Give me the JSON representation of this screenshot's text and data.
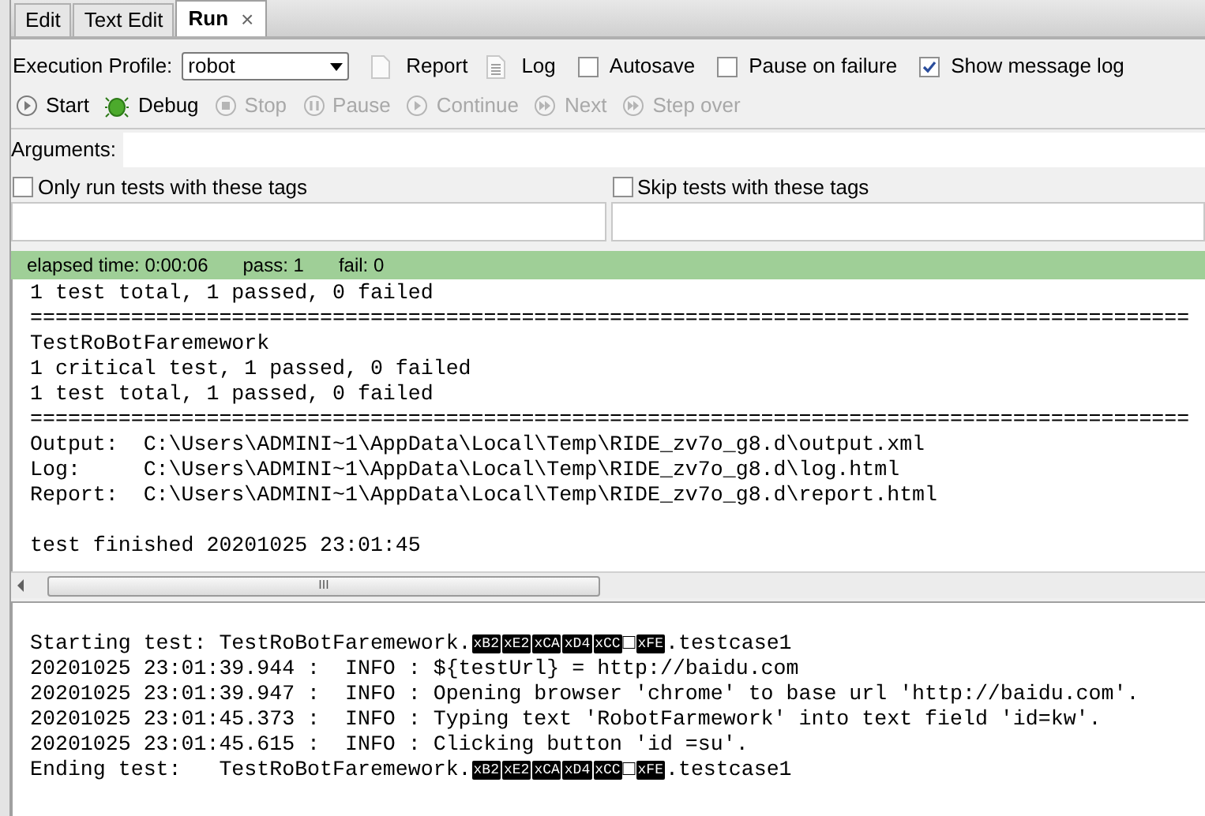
{
  "tabs": [
    {
      "label": "Edit",
      "selected": false
    },
    {
      "label": "Text Edit",
      "selected": false
    },
    {
      "label": "Run",
      "selected": true,
      "close": "×"
    }
  ],
  "profile": {
    "label": "Execution Profile:",
    "value": "robot"
  },
  "report_button": {
    "label": "Report"
  },
  "log_button": {
    "label": "Log"
  },
  "options": [
    {
      "label": "Autosave",
      "checked": false
    },
    {
      "label": "Pause on failure",
      "checked": false
    },
    {
      "label": "Show message log",
      "checked": true
    }
  ],
  "controls": [
    {
      "label": "Start",
      "kind": "play",
      "disabled": false
    },
    {
      "label": "Debug",
      "kind": "bug",
      "disabled": false
    },
    {
      "label": "Stop",
      "kind": "stop",
      "disabled": true
    },
    {
      "label": "Pause",
      "kind": "pause",
      "disabled": true
    },
    {
      "label": "Continue",
      "kind": "play",
      "disabled": true
    },
    {
      "label": "Next",
      "kind": "next",
      "disabled": true
    },
    {
      "label": "Step over",
      "kind": "next",
      "disabled": true
    }
  ],
  "arguments": {
    "label": "Arguments:"
  },
  "tag_filters": [
    {
      "label": "Only run tests with these tags",
      "checked": false
    },
    {
      "label": "Skip tests with these tags",
      "checked": false
    }
  ],
  "status": {
    "elapsed": "elapsed time: 0:00:06",
    "pass": "pass: 1",
    "fail": "fail: 0"
  },
  "output_lines": [
    {
      "kind": "text",
      "text": "1 test total, 1 passed, 0 failed"
    },
    {
      "kind": "text",
      "text": "============================================================================================"
    },
    {
      "kind": "text",
      "text": "TestRoBotFaremework"
    },
    {
      "kind": "text",
      "text": "1 critical test, 1 passed, 0 failed"
    },
    {
      "kind": "text",
      "text": "1 test total, 1 passed, 0 failed"
    },
    {
      "kind": "text",
      "text": "============================================================================================"
    },
    {
      "kind": "text",
      "text": "Output:  C:\\Users\\ADMINI~1\\AppData\\Local\\Temp\\RIDE_zv7o_g8.d\\output.xml"
    },
    {
      "kind": "text",
      "text": "Log:     C:\\Users\\ADMINI~1\\AppData\\Local\\Temp\\RIDE_zv7o_g8.d\\log.html"
    },
    {
      "kind": "text",
      "text": "Report:  C:\\Users\\ADMINI~1\\AppData\\Local\\Temp\\RIDE_zv7o_g8.d\\report.html"
    },
    {
      "kind": "blank"
    },
    {
      "kind": "text",
      "text": "test finished 20201025 23:01:45"
    }
  ],
  "scrollbar": {
    "grip": "III"
  },
  "message_log": [
    {
      "segments": [
        {
          "kind": "text",
          "text": "Starting test: TestRoBotFaremework."
        },
        {
          "kind": "byte",
          "text": "xB2"
        },
        {
          "kind": "byte",
          "text": "xE2"
        },
        {
          "kind": "byte",
          "text": "xCA"
        },
        {
          "kind": "byte",
          "text": "xD4"
        },
        {
          "kind": "byte",
          "text": "xCC"
        },
        {
          "kind": "text",
          "text": "□"
        },
        {
          "kind": "byte",
          "text": "xFE"
        },
        {
          "kind": "text",
          "text": ".testcase1"
        }
      ]
    },
    {
      "segments": [
        {
          "kind": "text",
          "text": "20201025 23:01:39.944 :  INFO : ${testUrl} = http://baidu.com"
        }
      ]
    },
    {
      "segments": [
        {
          "kind": "text",
          "text": "20201025 23:01:39.947 :  INFO : Opening browser 'chrome' to base url 'http://baidu.com'."
        }
      ]
    },
    {
      "segments": [
        {
          "kind": "text",
          "text": "20201025 23:01:45.373 :  INFO : Typing text 'RobotFarmework' into text field 'id=kw'."
        }
      ]
    },
    {
      "segments": [
        {
          "kind": "text",
          "text": "20201025 23:01:45.615 :  INFO : Clicking button 'id =su'."
        }
      ]
    },
    {
      "segments": [
        {
          "kind": "text",
          "text": "Ending test:   TestRoBotFaremework."
        },
        {
          "kind": "byte",
          "text": "xB2"
        },
        {
          "kind": "byte",
          "text": "xE2"
        },
        {
          "kind": "byte",
          "text": "xCA"
        },
        {
          "kind": "byte",
          "text": "xD4"
        },
        {
          "kind": "byte",
          "text": "xCC"
        },
        {
          "kind": "text",
          "text": "□"
        },
        {
          "kind": "byte",
          "text": "xFE"
        },
        {
          "kind": "text",
          "text": ".testcase1"
        }
      ]
    }
  ]
}
